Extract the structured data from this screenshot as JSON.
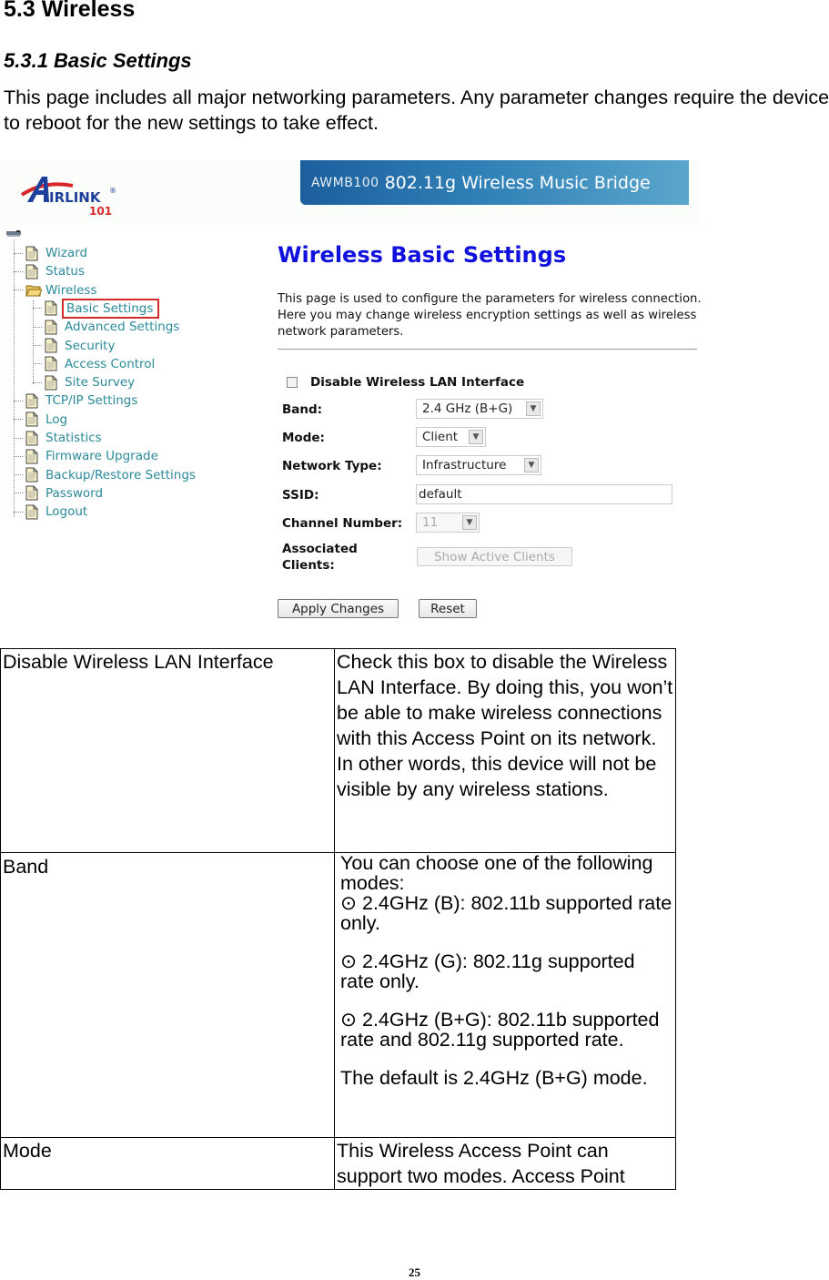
{
  "document": {
    "section_title": "5.3 Wireless",
    "subsection_title": "5.3.1 Basic Settings",
    "intro": "This page includes all major networking parameters. Any parameter changes require the device to reboot for the new settings to take effect.",
    "page_number": "25"
  },
  "screenshot": {
    "logo": {
      "brand": "AIRLINK",
      "reg": "®",
      "sub": "101"
    },
    "banner": {
      "model": "AWMB100",
      "product": "802.11g Wireless Music Bridge"
    },
    "tree": [
      {
        "label": "Wizard",
        "level": 1,
        "icon": "document-icon"
      },
      {
        "label": "Status",
        "level": 1,
        "icon": "document-icon"
      },
      {
        "label": "Wireless",
        "level": 1,
        "icon": "folder-open-icon"
      },
      {
        "label": "Basic Settings",
        "level": 2,
        "icon": "document-icon",
        "selected": true
      },
      {
        "label": "Advanced Settings",
        "level": 2,
        "icon": "document-icon"
      },
      {
        "label": "Security",
        "level": 2,
        "icon": "document-icon"
      },
      {
        "label": "Access Control",
        "level": 2,
        "icon": "document-icon"
      },
      {
        "label": "Site Survey",
        "level": 2,
        "icon": "document-icon"
      },
      {
        "label": "TCP/IP Settings",
        "level": 1,
        "icon": "document-icon"
      },
      {
        "label": "Log",
        "level": 1,
        "icon": "document-icon"
      },
      {
        "label": "Statistics",
        "level": 1,
        "icon": "document-icon"
      },
      {
        "label": "Firmware Upgrade",
        "level": 1,
        "icon": "document-icon"
      },
      {
        "label": "Backup/Restore Settings",
        "level": 1,
        "icon": "document-icon"
      },
      {
        "label": "Password",
        "level": 1,
        "icon": "document-icon"
      },
      {
        "label": "Logout",
        "level": 1,
        "icon": "document-icon"
      }
    ],
    "page_title": "Wireless Basic Settings",
    "page_description": "This page is used to configure the parameters for wireless connection. Here you may change wireless encryption settings as well as wireless network parameters.",
    "form": {
      "disable_wlan_label": "Disable Wireless LAN Interface",
      "disable_wlan_checked": false,
      "band_label": "Band:",
      "band_value": "2.4 GHz (B+G)",
      "mode_label": "Mode:",
      "mode_value": "Client",
      "network_type_label": "Network Type:",
      "network_type_value": "Infrastructure",
      "ssid_label": "SSID:",
      "ssid_value": "default",
      "channel_label": "Channel Number:",
      "channel_value": "11",
      "associated_label_1": "Associated",
      "associated_label_2": "Clients:",
      "show_clients_button": "Show Active Clients",
      "apply_button": "Apply Changes",
      "reset_button": "Reset"
    }
  },
  "table": {
    "rows": [
      {
        "key": "Disable Wireless LAN Interface",
        "value": "Check this box to disable the Wireless LAN Interface. By doing this, you won’t be able to make wireless connections with this Access Point on its network. In other words, this device will not be visible by any wireless stations."
      },
      {
        "key": "Band",
        "intro": "You can choose one of the following modes:",
        "bullet": "⊙",
        "options": [
          " 2.4GHz (B): 802.11b supported rate only.",
          "2.4GHz (G): 802.11g supported rate only.",
          "2.4GHz (B+G): 802.11b supported rate and 802.11g supported rate."
        ],
        "note": "The default is 2.4GHz (B+G) mode."
      },
      {
        "key": "Mode",
        "value": "This Wireless Access Point can support two modes.  Access Point"
      }
    ]
  }
}
